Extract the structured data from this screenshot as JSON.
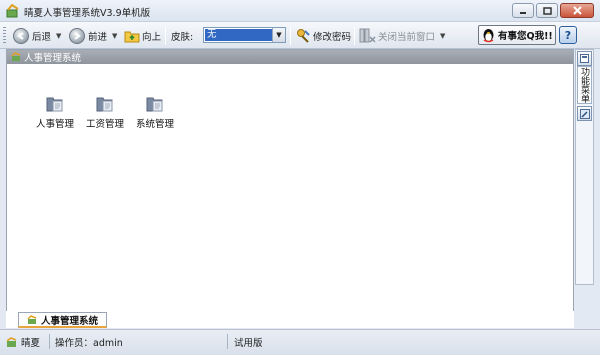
{
  "window": {
    "title": "晴夏人事管理系统V3.9单机版"
  },
  "toolbar": {
    "back_label": "后退",
    "forward_label": "前进",
    "up_label": "向上",
    "skin_label": "皮肤:",
    "skin_value": "无",
    "change_password_label": "修改密码",
    "close_window_label": "关闭当前窗口",
    "qq_label": "有事您Q我!!",
    "help_label": "?"
  },
  "panel": {
    "title": "人事管理系统"
  },
  "desktop_icons": [
    {
      "label": "人事管理"
    },
    {
      "label": "工资管理"
    },
    {
      "label": "系统管理"
    }
  ],
  "right_rail": {
    "menu_tab_label": "功能菜单"
  },
  "tabs": [
    {
      "label": "人事管理系统"
    }
  ],
  "status": {
    "company": "晴夏",
    "operator": "操作员：admin",
    "edition": "试用版"
  },
  "colors": {
    "selection_blue": "#3168c3",
    "header_gray": "#9aa0a8",
    "active_tab_accent": "#e8a53d"
  }
}
